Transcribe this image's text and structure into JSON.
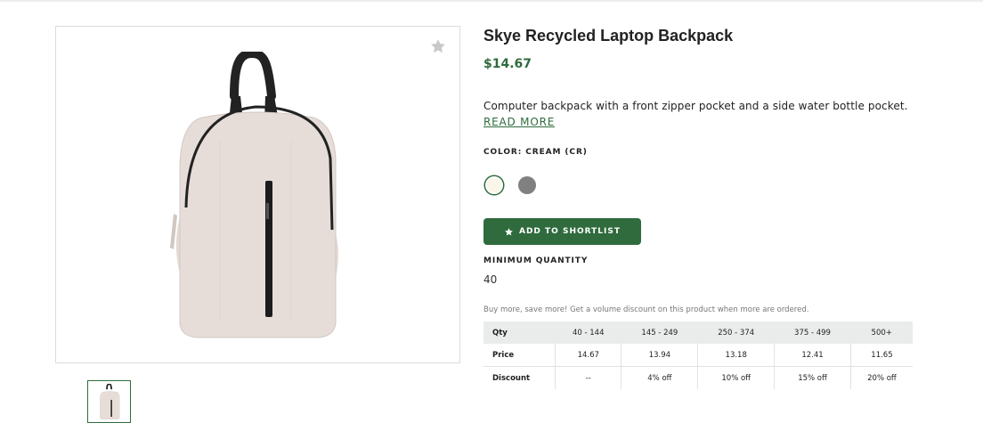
{
  "product": {
    "title": "Skye Recycled Laptop Backpack",
    "price": "$14.67",
    "description": "Computer backpack with a front zipper pocket and a side water bottle pocket.",
    "read_more_label": "READ MORE",
    "color_label": "COLOR: CREAM (CR)",
    "swatches": [
      {
        "name": "Cream",
        "hex": "#fbf7e8",
        "selected": true
      },
      {
        "name": "Grey",
        "hex": "#808080",
        "selected": false
      }
    ],
    "shortlist_label": "ADD TO SHORTLIST",
    "min_qty_label": "MINIMUM QUANTITY",
    "min_qty_value": "40",
    "volume_note": "Buy more, save more! Get a volume discount on this product when more are ordered."
  },
  "pricing_table": {
    "header": [
      "Qty",
      "40 - 144",
      "145 - 249",
      "250 - 374",
      "375 - 499",
      "500+"
    ],
    "price_row": [
      "Price",
      "14.67",
      "13.94",
      "13.18",
      "12.41",
      "11.65"
    ],
    "discount_row": [
      "Discount",
      "--",
      "4% off",
      "10% off",
      "15% off",
      "20% off"
    ]
  },
  "icons": {
    "favorite": "star-icon",
    "shortlist": "star-icon"
  },
  "colors": {
    "accent": "#2f6b3d",
    "table_header_bg": "#e9ecea"
  }
}
